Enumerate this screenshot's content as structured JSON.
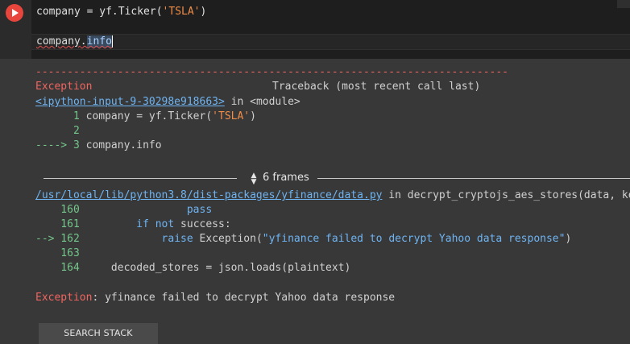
{
  "cell": {
    "code_line1_prefix": "company = yf.Ticker(",
    "code_line1_string": "'TSLA'",
    "code_line1_suffix": ")",
    "code_line2_obj": "company",
    "code_line2_dot": ".",
    "code_line2_attr": "info"
  },
  "output": {
    "separator": "---------------------------------------------------------------------------",
    "exception_name": "Exception",
    "traceback_header": "Traceback (most recent call last)",
    "frame1_link": "<ipython-input-9-30298e918663>",
    "frame1_in": " in ",
    "frame1_module": "<module>",
    "frame1_lines": [
      {
        "num": "      1",
        "code_prefix": " company = yf.Ticker(",
        "code_string": "'TSLA'",
        "code_suffix": ")"
      },
      {
        "num": "      2",
        "code": ""
      },
      {
        "arrow": "----> 3",
        "code": " company.info"
      }
    ],
    "frames_label": "6 frames",
    "frame2_link": "/usr/local/lib/python3.8/dist-packages/yfinance/data.py",
    "frame2_in": " in decrypt_cryptojs_aes_stores(data, keys)",
    "frame2_lines": [
      {
        "num": "    160",
        "code": "                 pass"
      },
      {
        "num": "    161",
        "indent": "         ",
        "kw": "if not",
        "code": " success:"
      },
      {
        "arrow": "--> 162",
        "indent": "             ",
        "kw": "raise",
        "code_mid": " Exception(",
        "code_string": "\"yfinance failed to decrypt Yahoo data response\"",
        "code_suffix": ")"
      },
      {
        "num": "    163",
        "code": ""
      },
      {
        "num": "    164",
        "code": "     decoded_stores = json.loads(plaintext)"
      }
    ],
    "final_exception_name": "Exception",
    "final_message": ": yfinance failed to decrypt Yahoo data response",
    "search_button": "SEARCH STACK OVERFLOW"
  }
}
